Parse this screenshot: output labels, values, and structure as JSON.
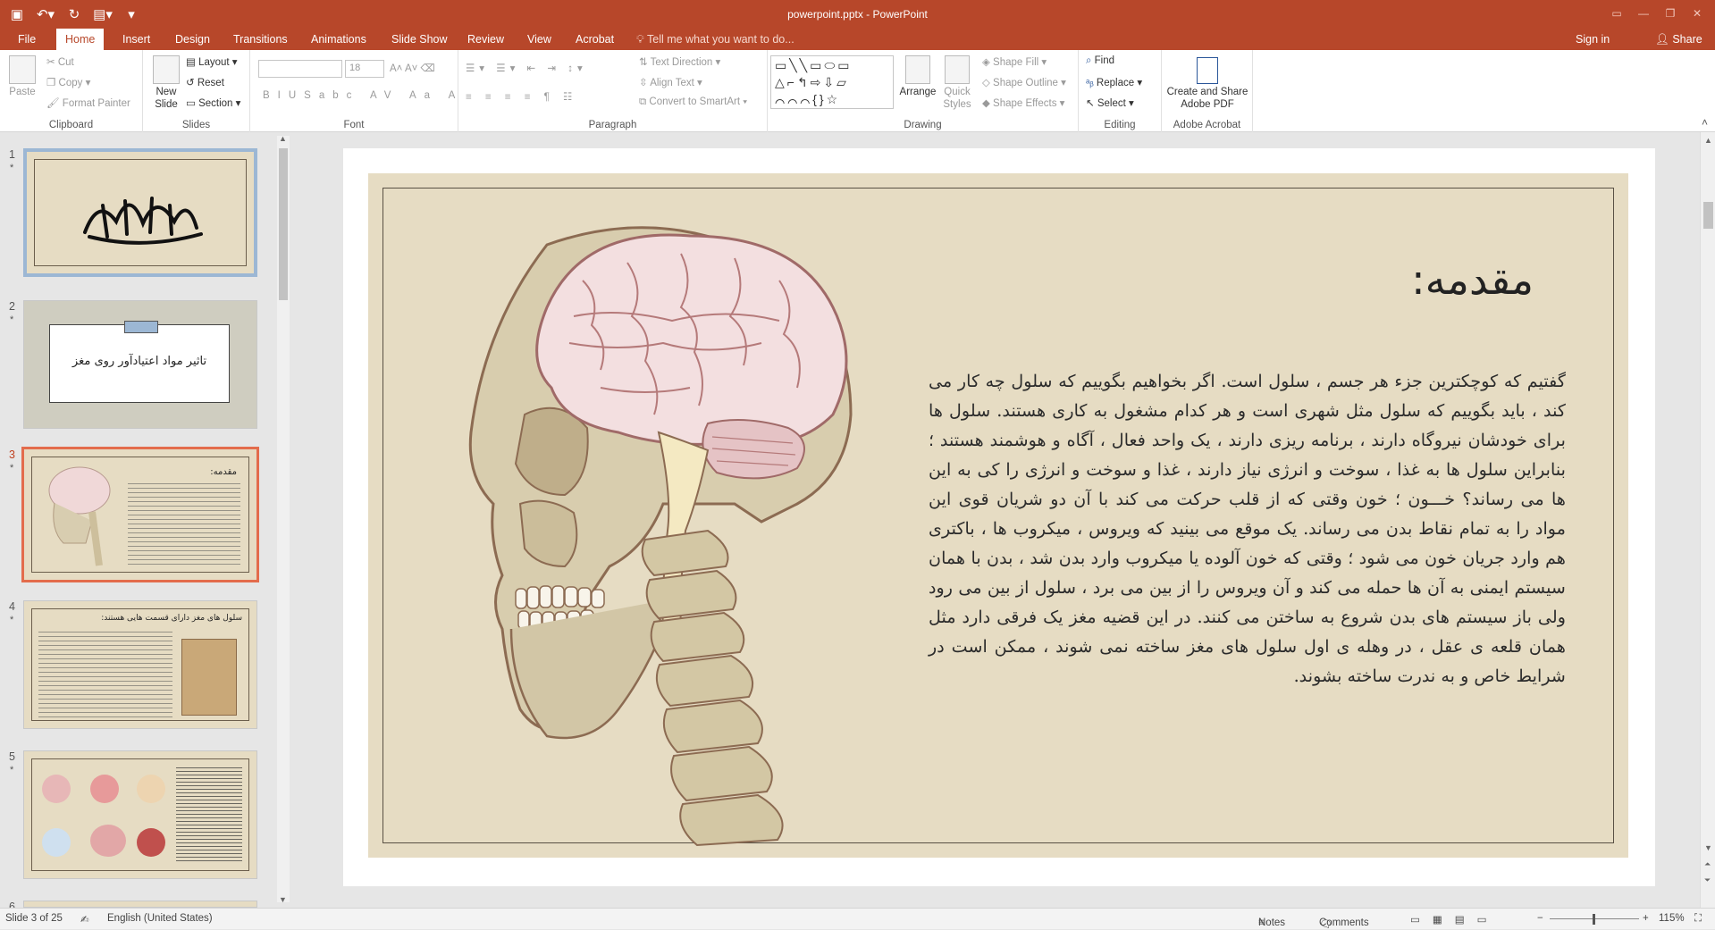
{
  "window": {
    "title": "powerpoint.pptx - PowerPoint"
  },
  "qat": {
    "save_icon": "save-icon",
    "undo_icon": "undo-icon",
    "redo_icon": "repeat-icon",
    "customize_icon": "customize-icon"
  },
  "tabs": [
    "File",
    "Home",
    "Insert",
    "Design",
    "Transitions",
    "Animations",
    "Slide Show",
    "Review",
    "View",
    "Acrobat"
  ],
  "active_tab": "Home",
  "tell_me": "Tell me what you want to do...",
  "sign_in": "Sign in",
  "share": "Share",
  "ribbon": {
    "clipboard": {
      "label": "Clipboard",
      "paste": "Paste",
      "cut": "Cut",
      "copy": "Copy",
      "format_painter": "Format Painter"
    },
    "slides": {
      "label": "Slides",
      "new_slide": "New Slide",
      "layout": "Layout",
      "reset": "Reset",
      "section": "Section"
    },
    "font": {
      "label": "Font",
      "font_name": "",
      "font_size": "18"
    },
    "paragraph": {
      "label": "Paragraph",
      "text_direction": "Text Direction",
      "align_text": "Align Text",
      "convert_smartart": "Convert to SmartArt"
    },
    "drawing": {
      "label": "Drawing",
      "arrange": "Arrange",
      "quick_styles": "Quick Styles",
      "shape_fill": "Shape Fill",
      "shape_outline": "Shape Outline",
      "shape_effects": "Shape Effects"
    },
    "editing": {
      "label": "Editing",
      "find": "Find",
      "replace": "Replace",
      "select": "Select"
    },
    "acrobat": {
      "label": "Adobe Acrobat",
      "create_share": "Create and Share Adobe PDF"
    }
  },
  "thumbnails": [
    {
      "num": "1",
      "star": "*"
    },
    {
      "num": "2",
      "star": "*",
      "text": "تاثیر مواد اعتیادآور روی مغز"
    },
    {
      "num": "3",
      "star": "*",
      "text": "مقدمه:"
    },
    {
      "num": "4",
      "star": "*",
      "text": "سلول های مغز دارای قسمت هایی هستند:"
    },
    {
      "num": "5",
      "star": "*"
    },
    {
      "num": "6"
    }
  ],
  "slide": {
    "title": "مقدمه:",
    "body": "گفتیم که کوچکترین جزء هر جسم ، سلول است. اگر بخواهیم بگوییم که سلول چه کار می کند ، باید بگوییم که سلول مثل شهری است و هر کدام مشغول به کاری هستند. سلول ها برای خودشان نیروگاه دارند ، برنامه ریزی دارند ، یک واحد فعال ، آگاه و هوشمند هستند ؛ بنابراین سلول ها به غذا ، سوخت و انرژی نیاز دارند ، غذا و سوخت و انرژی را کی به این ها می رساند؟ خـــون ؛ خون وقتی که از قلب حرکت می کند با آن دو شریان قوی این مواد را به تمام نقاط بدن می رساند. یک موقع می بینید که ویروس ، میکروب ها ، باکتری هم وارد جریان خون می شود ؛ وقتی که خون آلوده یا میکروب وارد بدن شد ، بدن با همان سیستم ایمنی به آن ها حمله می کند و آن ویروس را از بین می برد ، سلول از بین می رود ولی باز سیستم های بدن شروع به ساختن می کنند. در این قضیه مغز یک فرقی دارد مثل همان قلعه ی عقل ، در وهله ی اول سلول های مغز ساخته نمی شوند ، ممکن است در شرایط خاص و به ندرت ساخته بشوند."
  },
  "status": {
    "slide_info": "Slide 3 of 25",
    "language": "English (United States)",
    "notes": "Notes",
    "comments": "Comments",
    "zoom": "115%"
  }
}
